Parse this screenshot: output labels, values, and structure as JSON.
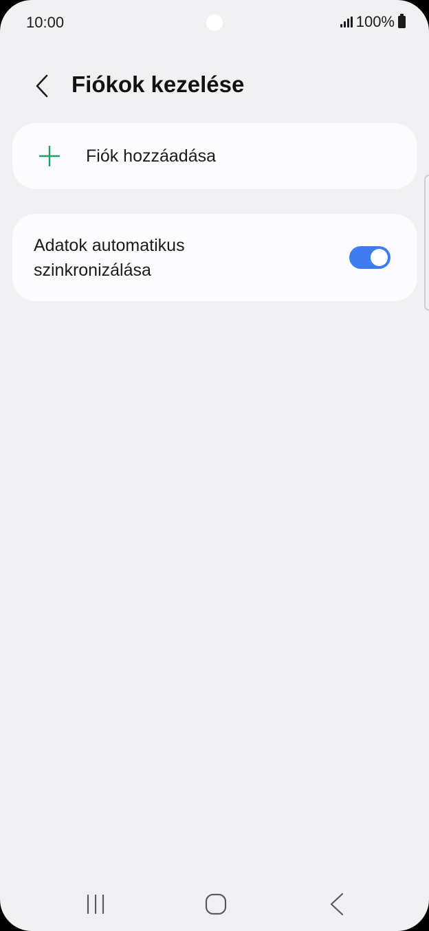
{
  "status_bar": {
    "time": "10:00",
    "battery": "100%"
  },
  "header": {
    "title": "Fiókok kezelése",
    "back_icon": "chevron-left-icon"
  },
  "add_account": {
    "label": "Fiók hozzáadása",
    "icon": "plus-icon",
    "icon_color": "#1e9e6a"
  },
  "auto_sync": {
    "label": "Adatok automatikus szinkronizálása",
    "enabled": true,
    "toggle_color": "#3e7cf0"
  },
  "nav_bar": {
    "recents_icon": "recents-icon",
    "home_icon": "home-icon",
    "back_icon": "back-icon"
  }
}
